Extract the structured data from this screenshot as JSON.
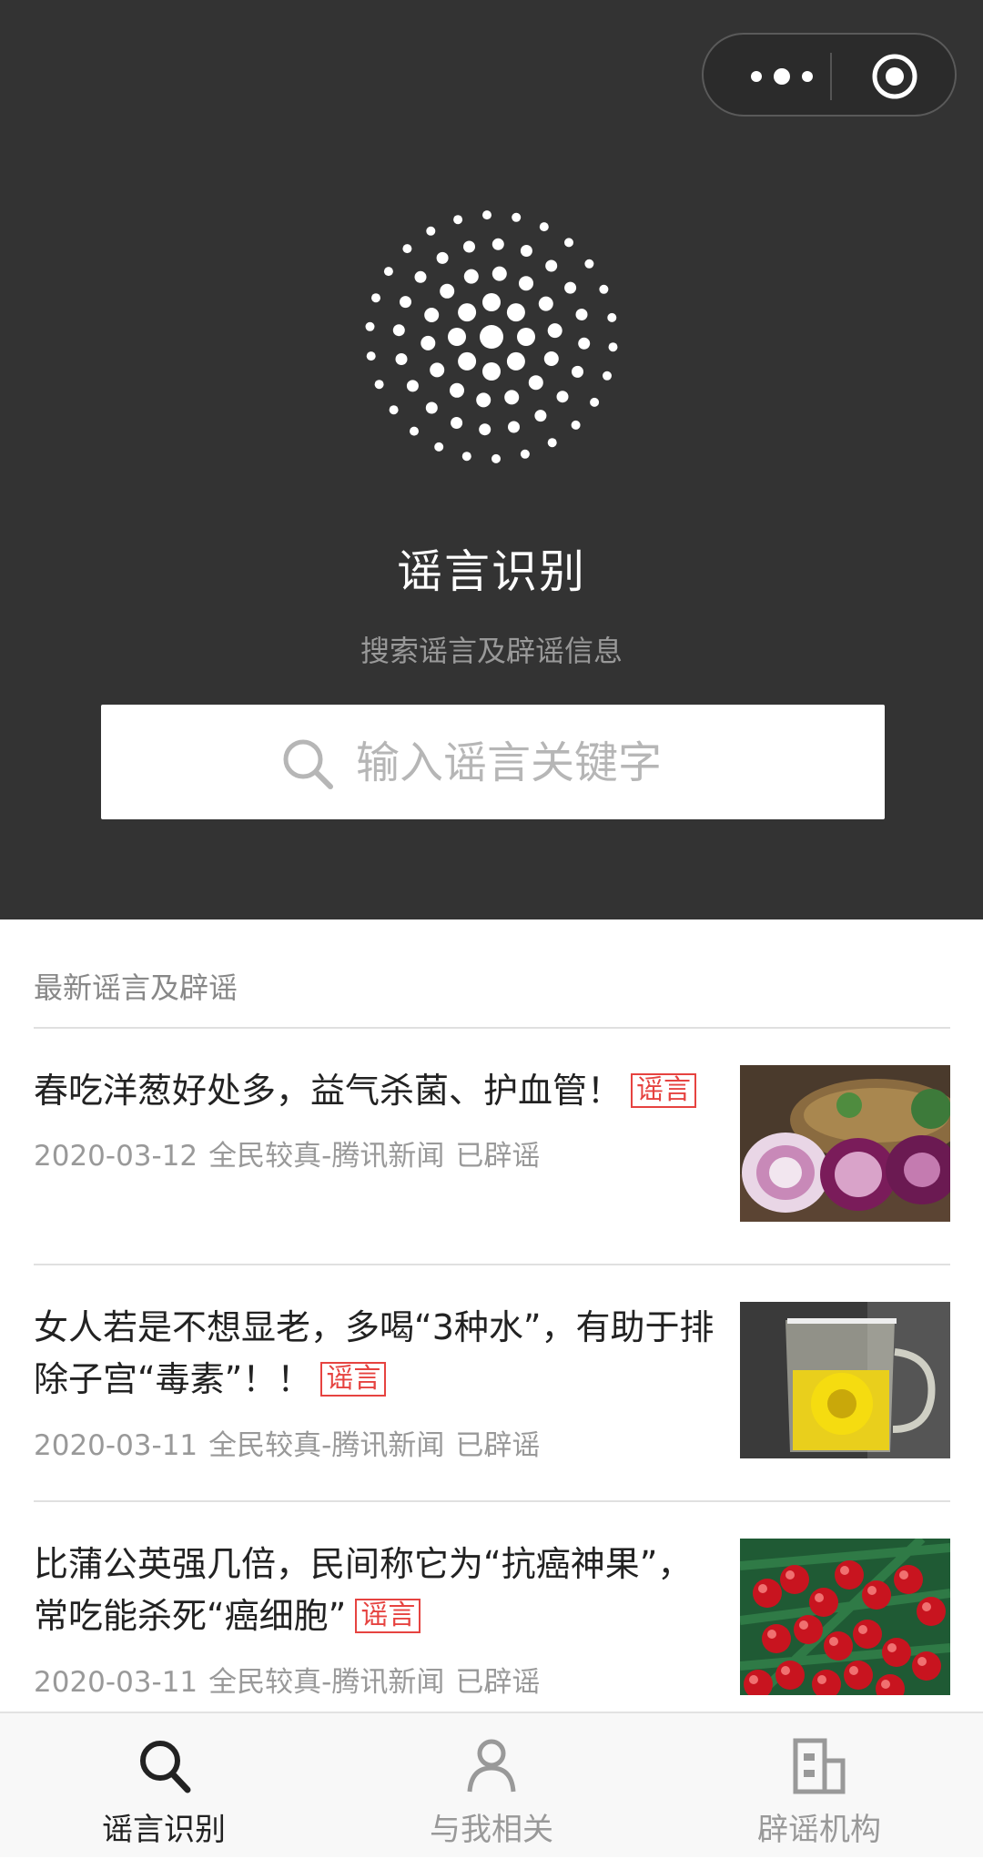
{
  "header": {
    "title": "谣言识别",
    "subtitle": "搜索谣言及辟谣信息",
    "search": {
      "placeholder": "输入谣言关键字",
      "icon": "search-icon"
    },
    "capsule": {
      "more_icon": "more-dots-icon",
      "close_icon": "target-icon"
    }
  },
  "feed": {
    "section_title": "最新谣言及辟谣",
    "items": [
      {
        "title": "春吃洋葱好处多，益气杀菌、护血管！",
        "tag": "谣言",
        "date": "2020-03-12",
        "source": "全民较真-腾讯新闻",
        "status": "已辟谣",
        "thumb": "onion"
      },
      {
        "title": "女人若是不想显老，多喝“3种水”，有助于排除子宫“毒素”！！",
        "tag": "谣言",
        "date": "2020-03-11",
        "source": "全民较真-腾讯新闻",
        "status": "已辟谣",
        "thumb": "flower-tea"
      },
      {
        "title": "比蒲公英强几倍，民间称它为“抗癌神果”，常吃能杀死“癌细胞”",
        "tag": "谣言",
        "date": "2020-03-11",
        "source": "全民较真-腾讯新闻",
        "status": "已辟谣",
        "thumb": "red-berries"
      }
    ]
  },
  "tabbar": {
    "tabs": [
      {
        "label": "谣言识别",
        "icon": "search-icon",
        "active": true
      },
      {
        "label": "与我相关",
        "icon": "user-icon",
        "active": false
      },
      {
        "label": "辟谣机构",
        "icon": "building-icon",
        "active": false
      }
    ]
  },
  "colors": {
    "header_bg": "#333333",
    "tag_red": "#e64340",
    "tab_active": "#222222",
    "tab_inactive": "#999999"
  }
}
